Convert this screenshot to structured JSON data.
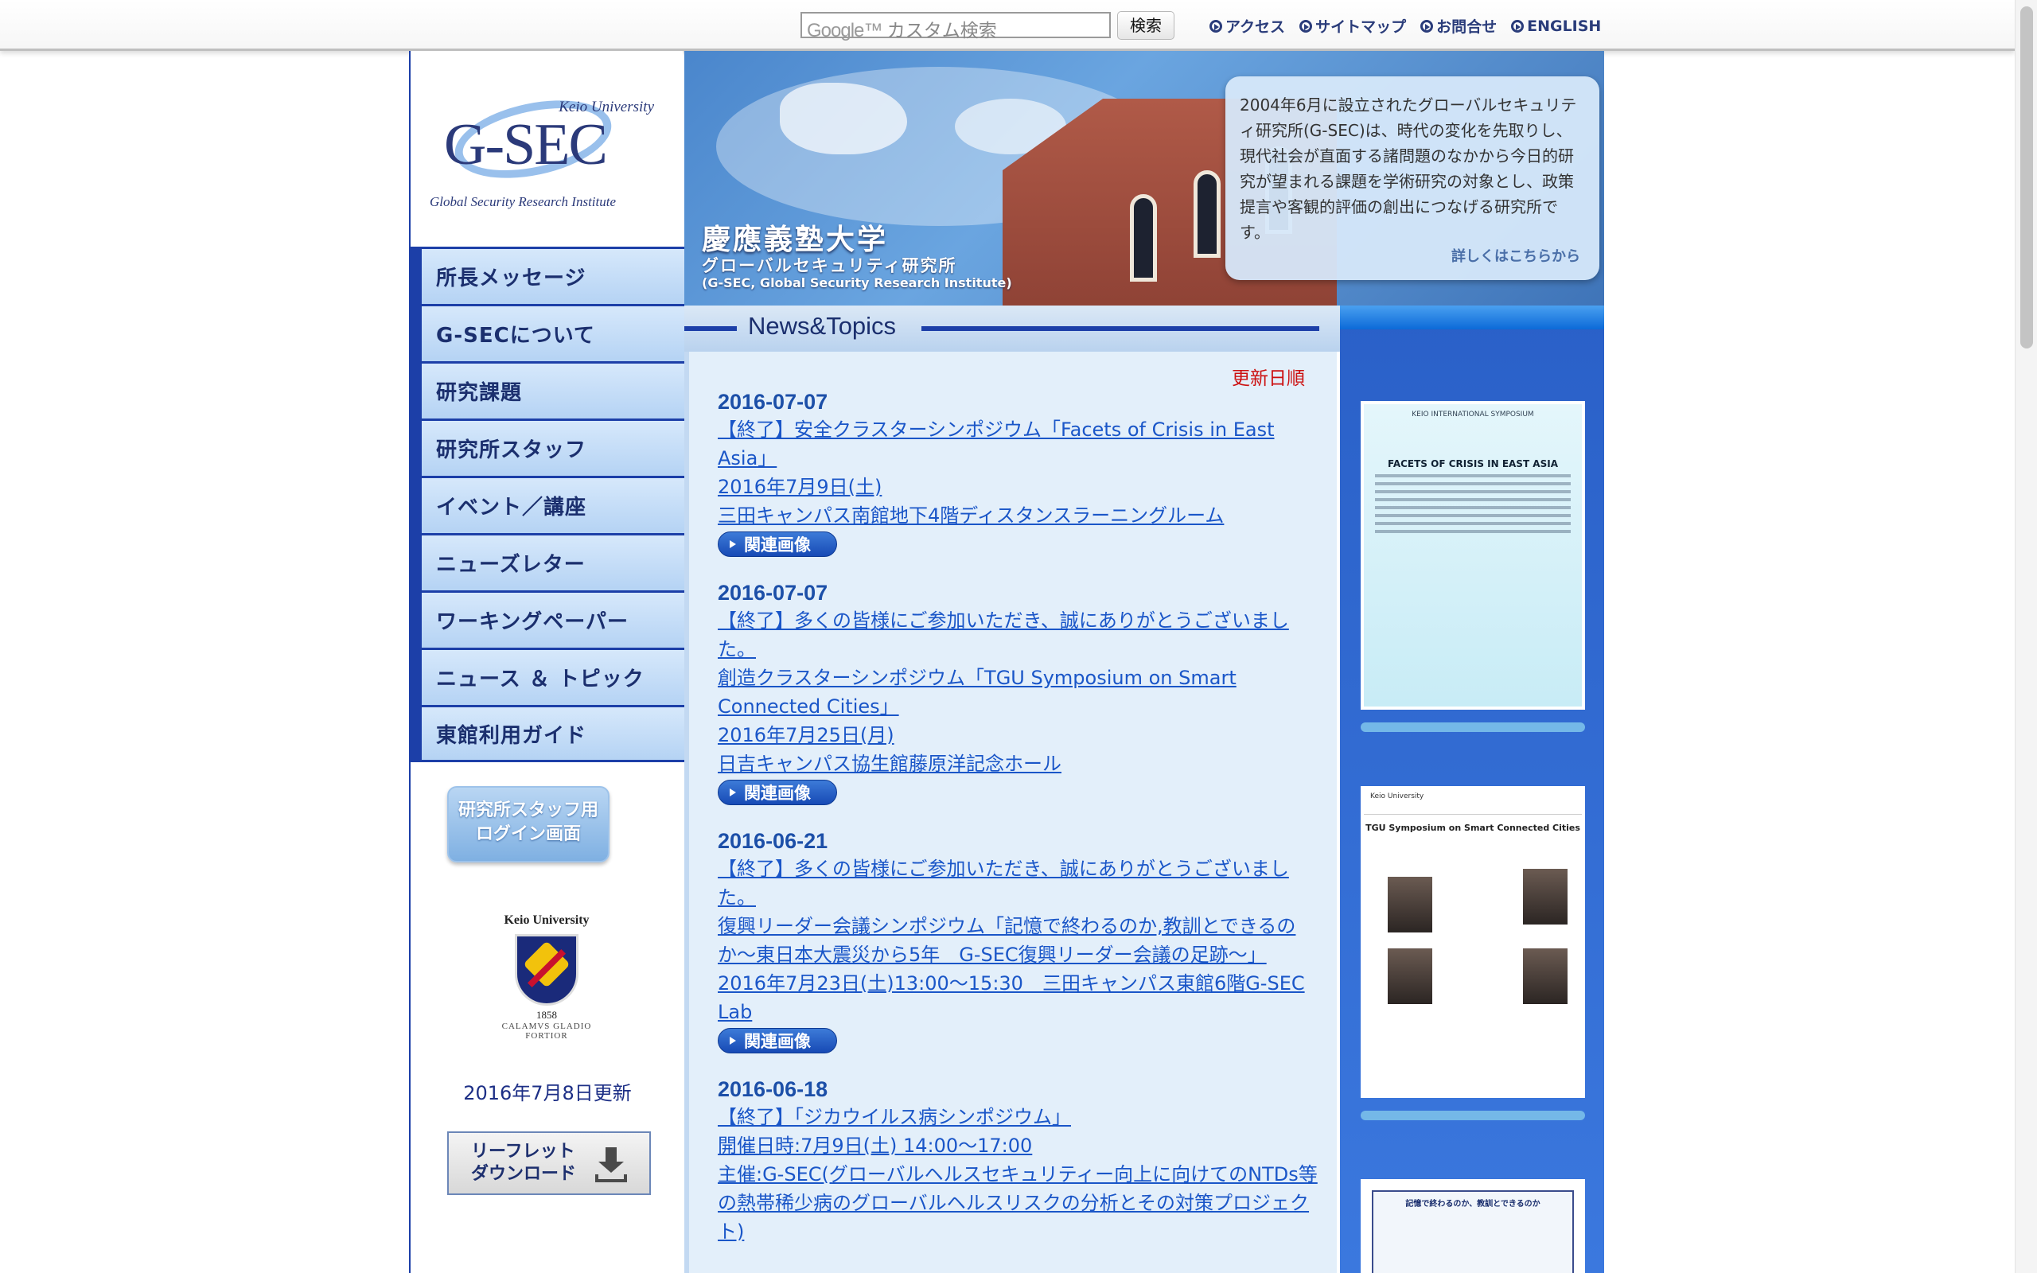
{
  "topbar": {
    "search_placeholder": "カスタム検索",
    "search_logo": "Google™",
    "search_button": "検索",
    "links": [
      "アクセス",
      "サイトマップ",
      "お問合せ",
      "ENGLISH"
    ]
  },
  "logo": {
    "keio": "Keio University",
    "main": "G-SEC",
    "sub": "Global Security Research Institute"
  },
  "nav": {
    "items": [
      "所長メッセージ",
      "G-SECについて",
      "研究課題",
      "研究所スタッフ",
      "イベント／講座",
      "ニューズレター",
      "ワーキングペーパー",
      "ニュース ＆ トピック",
      "東館利用ガイド"
    ]
  },
  "sidebar": {
    "staff_login_line1": "研究所スタッフ用",
    "staff_login_line2": "ログイン画面",
    "crest_title": "Keio University",
    "crest_year": "1858",
    "crest_motto": "CALAMVS GLADIO FORTIOR",
    "updated": "2016年7月8日更新",
    "leaflet_line1": "リーフレット",
    "leaflet_line2": "ダウンロード"
  },
  "hero": {
    "title": "慶應義塾大学",
    "sub1": "グローバルセキュリティ研究所",
    "sub2": "(G-SEC, Global Security Research Institute)",
    "box_text": "2004年6月に設立されたグローバルセキュリティ研究所(G-SEC)は、時代の変化を先取りし、現代社会が直面する諸問題のなかから今日的研究が望まれる課題を学術研究の対象とし、政策提言や客観的評価の創出につなげる研究所です。",
    "box_link": "詳しくはこちらから"
  },
  "news": {
    "header": "News&Topics",
    "sort_label": "更新日順",
    "image_button": "関連画像",
    "items": [
      {
        "date": "2016-07-07",
        "lines": [
          "【終了】安全クラスターシンポジウム「Facets of Crisis in East Asia」",
          "2016年7月9日(土)",
          "三田キャンパス南館地下4階ディスタンスラーニングルーム"
        ]
      },
      {
        "date": "2016-07-07",
        "lines": [
          "【終了】多くの皆様にご参加いただき、誠にありがとうございました。",
          "創造クラスターシンポジウム「TGU Symposium on Smart Connected Cities」",
          "2016年7月25日(月)",
          "日吉キャンパス協生館藤原洋記念ホール"
        ]
      },
      {
        "date": "2016-06-21",
        "lines": [
          "【終了】多くの皆様にご参加いただき、誠にありがとうございました。",
          "復興リーダー会議シンポジウム「記憶で終わるのか,教訓とできるのか〜東日本大震災から5年　G-SEC復興リーダー会議の足跡〜」",
          "2016年7月23日(土)13:00〜15:30　三田キャンパス東館6階G-SEC Lab"
        ]
      },
      {
        "date": "2016-06-18",
        "lines": [
          "【終了】「ジカウイルス病シンポジウム」",
          "開催日時:7月9日(土) 14:00〜17:00",
          "主催:G-SEC(グローバルヘルスセキュリティー向上に向けてのNTDs等の熱帯稀少病のグローバルヘルスリスクの分析とその対策プロジェクト)"
        ]
      }
    ]
  },
  "posters": {
    "p1_head": "KEIO INTERNATIONAL SYMPOSIUM",
    "p1_title": "FACETS OF CRISIS IN EAST ASIA",
    "p2_top": "Keio University",
    "p2_title": "TGU Symposium on Smart Connected Cities",
    "p3_text": "記憶で終わるのか、教訓とできるのか"
  }
}
